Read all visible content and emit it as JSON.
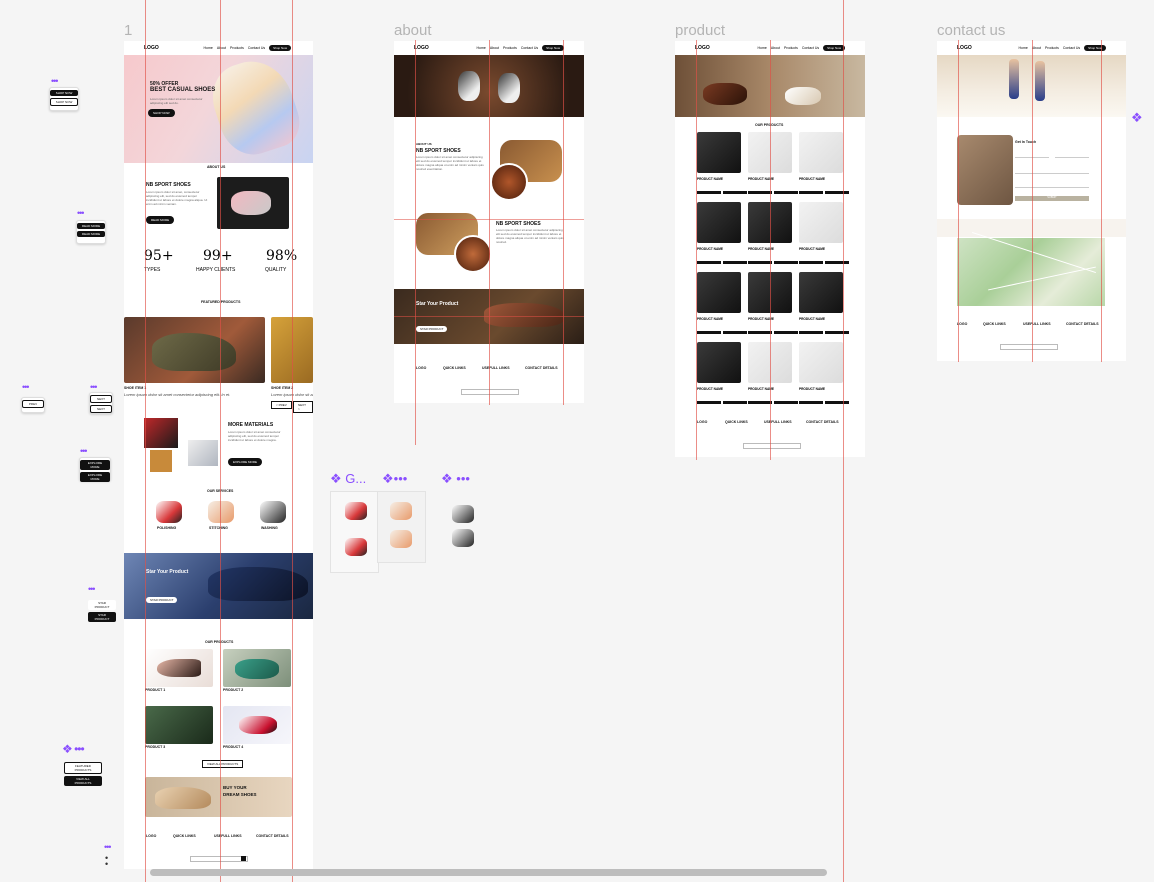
{
  "frames": {
    "home": {
      "label": "1"
    },
    "about": {
      "label": "about"
    },
    "product": {
      "label": "product"
    },
    "contact": {
      "label": "contact us"
    }
  },
  "nav": {
    "logo": "LOGO",
    "links": [
      "Home",
      "About",
      "Products",
      "Contact Us"
    ],
    "cta": "Shop Now"
  },
  "home": {
    "hero_offer": "50% OFFER",
    "hero_title": "BEST CASUAL SHOES",
    "hero_button": "SHOP NOW",
    "about_heading": "ABOUT US",
    "about_title": "NB SPORT SHOES",
    "read_more": "READ MORE",
    "stats": [
      {
        "value": "95+",
        "label": "TYPES"
      },
      {
        "value": "99+",
        "label": "HAPPY CLIENTS"
      },
      {
        "value": "98%",
        "label": "QUALITY"
      }
    ],
    "featured_heading": "FEATURED PRODUCTS",
    "featured_items": [
      "SHOE ITEM 1",
      "SHOE ITEM 2"
    ],
    "featured_desc": "Lorem ipsum dolor sit amet consectetur adipiscing elit. In et.",
    "more_materials": "MORE MATERIALS",
    "explore_more": "EXPLORE MORE",
    "services_heading": "OUR SERVICES",
    "services": [
      "POLISHING",
      "STITCHING",
      "WASHING"
    ],
    "star_title": "Star Your Product",
    "star_button": "STAR PRODUCT",
    "our_products": "OUR PRODUCTS",
    "products": [
      "PRODUCT 1",
      "PRODUCT 2",
      "PRODUCT 3",
      "PRODUCT 4"
    ],
    "view_all": "VIEW ALL PRODUCTS",
    "buy_line1": "BUY YOUR",
    "buy_line2": "DREAM SHOES"
  },
  "footer": {
    "logo": "LOGO",
    "cols": [
      "QUICK LINKS",
      "USEFULL LINKS",
      "CONTACT DETAILS"
    ]
  },
  "about": {
    "about_label": "ABOUT US",
    "title1": "NB SPORT SHOES",
    "title2": "NB SPORT SHOES",
    "star_title": "Star Your Product",
    "star_button": "STAR PRODUCT"
  },
  "product": {
    "heading": "OUR PRODUCTS",
    "item_name": "PRODUCT NAME"
  },
  "contact": {
    "form_title": "Get In Touch",
    "submit": "SUBMIT"
  },
  "components": {
    "shop_now": "SHOP NOW",
    "read_more": "READ MORE",
    "next": "NEXT",
    "explore_more": "EXPLORE MORE",
    "star_product": "STAR PRODUCT",
    "featured_products": "FEATURED PRODUCTS",
    "view_all": "VIEW ALL PRODUCTS",
    "group_label": "G..."
  },
  "colors": {
    "guide": "#e05046",
    "component_accent": "#8a4fff",
    "canvas": "#f5f5f5"
  }
}
